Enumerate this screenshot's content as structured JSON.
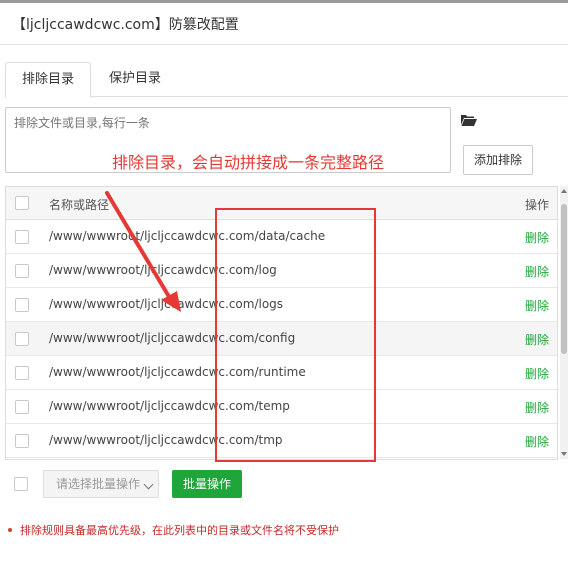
{
  "dialog": {
    "title": "【ljcljccawdcwc.com】防篡改配置"
  },
  "tabs": [
    {
      "label": "排除目录",
      "active": true
    },
    {
      "label": "保护目录",
      "active": false
    }
  ],
  "input": {
    "placeholder": "排除文件或目录,每行一条",
    "value": ""
  },
  "buttons": {
    "add_exclude": "添加排除",
    "batch_apply": "批量操作"
  },
  "table": {
    "headers": {
      "name": "名称或路径",
      "op": "操作"
    },
    "rows": [
      {
        "path": "/www/wwwroot/ljcljccawdcwc.com/data/cache",
        "action": "删除"
      },
      {
        "path": "/www/wwwroot/ljcljccawdcwc.com/log",
        "action": "删除"
      },
      {
        "path": "/www/wwwroot/ljcljccawdcwc.com/logs",
        "action": "删除"
      },
      {
        "path": "/www/wwwroot/ljcljccawdcwc.com/config",
        "action": "删除"
      },
      {
        "path": "/www/wwwroot/ljcljccawdcwc.com/runtime",
        "action": "删除"
      },
      {
        "path": "/www/wwwroot/ljcljccawdcwc.com/temp",
        "action": "删除"
      },
      {
        "path": "/www/wwwroot/ljcljccawdcwc.com/tmp",
        "action": "删除"
      }
    ]
  },
  "batch": {
    "select_placeholder": "请选择批量操作"
  },
  "note": "排除规则具备最高优先级，在此列表中的目录或文件名将不受保护",
  "annotation": {
    "text": "排除目录，会自动拼接成一条完整路径",
    "color": "#e53935"
  },
  "colors": {
    "accent": "#20a53a",
    "warning": "#c62828"
  },
  "icons": {
    "folder": "folder-open-icon"
  }
}
